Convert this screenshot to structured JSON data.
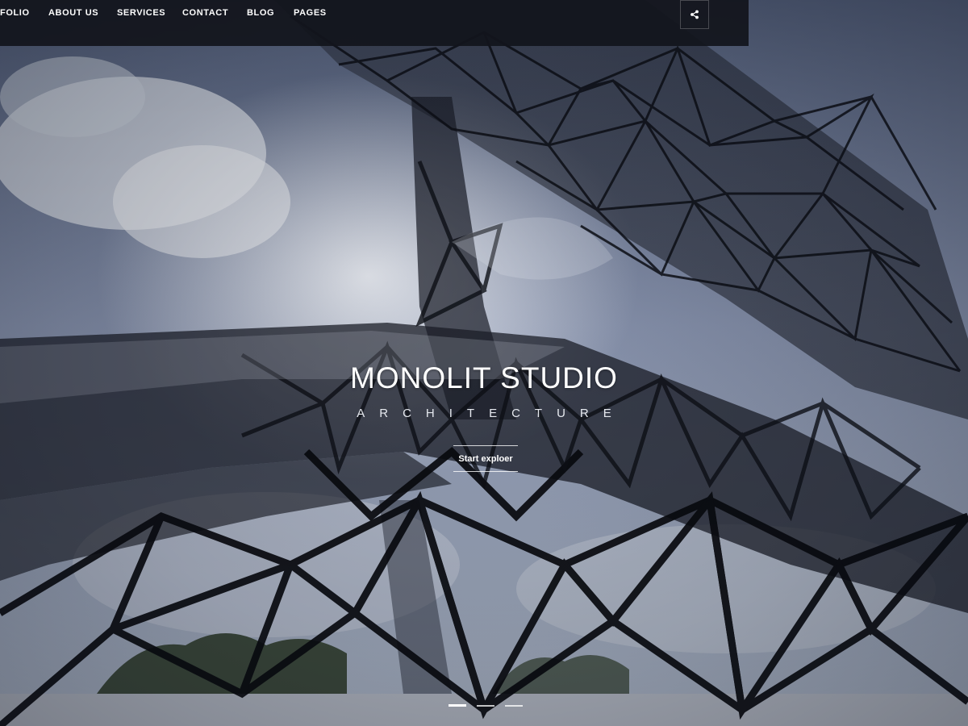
{
  "nav": {
    "items": [
      {
        "label": "FOLIO"
      },
      {
        "label": "ABOUT US"
      },
      {
        "label": "SERVICES"
      },
      {
        "label": "CONTACT"
      },
      {
        "label": "BLOG"
      },
      {
        "label": "PAGES"
      }
    ],
    "share_icon": "share-icon"
  },
  "hero": {
    "title": "MONOLIT STUDIO",
    "subtitle": "ARCHITECTURE",
    "cta_label": "Start exploer",
    "background_image": "lattice-structure-sky-photo"
  },
  "slider": {
    "slide_count": 3,
    "active_index": 0
  },
  "colors": {
    "nav_background": "#12141c",
    "text": "#ffffff"
  }
}
